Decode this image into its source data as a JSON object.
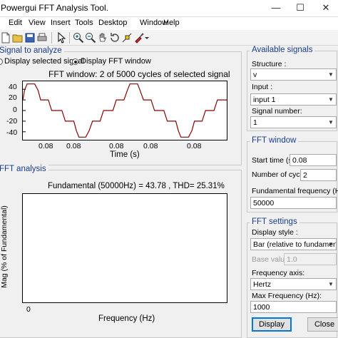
{
  "window": {
    "title": "Powergui FFT Analysis Tool."
  },
  "menu": [
    "Edit",
    "View",
    "Insert",
    "Tools",
    "Desktop",
    "Window",
    "Help"
  ],
  "toolbar_icons": [
    "new-file-icon",
    "open-folder-icon",
    "save-icon",
    "print-icon",
    "pointer-icon",
    "zoom-in-icon",
    "zoom-out-icon",
    "pan-hand-icon",
    "rotate-icon",
    "data-cursor-icon",
    "brush-icon",
    "dropdown-arrow-icon"
  ],
  "signal_panel": {
    "title": "Signal to analyze",
    "radio_selected_label": "Display selected signal",
    "radio_fft_label": "Display FFT window",
    "radio_fft_on": true,
    "plot_title": "FFT window: 2 of 5000 cycles of selected signal",
    "y_ticks": [
      "40",
      "20",
      "0",
      "-20",
      "-40"
    ],
    "x_ticks": [
      "0.08",
      "0.08",
      "0.08",
      "0.08",
      "0.08"
    ],
    "xlabel": "Time (s)",
    "line_color": "#8b0000"
  },
  "fft_panel": {
    "title": "FFT analysis",
    "plot_title": "Fundamental (50000Hz) = 43.78 , THD= 25.31%",
    "ylabel": "Mag (% of Fundamental)",
    "x_tick": "0",
    "xlabel": "Frequency (Hz)"
  },
  "available_signals": {
    "title": "Available signals",
    "structure_label": "Structure :",
    "structure_value": "v",
    "input_label": "Input :",
    "input_value": "input 1",
    "signal_number_label": "Signal number:",
    "signal_number_value": "1"
  },
  "fft_window": {
    "title": "FFT window",
    "start_time_label": "Start time (s):",
    "start_time_value": "0.08",
    "cycles_label": "Number of cycles:",
    "cycles_value": "2",
    "fund_freq_label": "Fundamental frequency (Hz):",
    "fund_freq_value": "50000"
  },
  "fft_settings": {
    "title": "FFT settings",
    "display_style_label": "Display style :",
    "display_style_value": "Bar (relative to fundamental)",
    "base_value_label": "Base value:",
    "base_value_value": "1.0",
    "freq_axis_label": "Frequency axis:",
    "freq_axis_value": "Hertz",
    "max_freq_label": "Max Frequency (Hz):",
    "max_freq_value": "1000"
  },
  "buttons": {
    "display": "Display",
    "close": "Close"
  },
  "chart_data": {
    "type": "line",
    "title": "FFT window: 2 of 5000 cycles of selected signal",
    "xlabel": "Time (s)",
    "ylabel": "",
    "ylim": [
      -55,
      55
    ],
    "y_ticks": [
      40,
      20,
      0,
      -20,
      -40
    ],
    "series": [
      {
        "values_description_free": true,
        "points": [
          [
            0,
            20
          ],
          [
            2,
            38
          ],
          [
            5,
            50
          ],
          [
            14,
            50
          ],
          [
            18,
            38
          ],
          [
            21,
            20
          ],
          [
            30,
            20
          ],
          [
            34,
            0
          ],
          [
            46,
            0
          ],
          [
            50,
            -20
          ],
          [
            60,
            -20
          ],
          [
            63,
            -38
          ],
          [
            66,
            -50
          ],
          [
            74,
            -50
          ],
          [
            78,
            -38
          ],
          [
            82,
            -20
          ],
          [
            91,
            -20
          ],
          [
            95,
            0
          ],
          [
            106,
            0
          ],
          [
            110,
            20
          ],
          [
            119,
            20
          ],
          [
            123,
            38
          ],
          [
            126,
            50
          ],
          [
            135,
            50
          ],
          [
            138,
            38
          ],
          [
            142,
            20
          ],
          [
            151,
            20
          ],
          [
            155,
            0
          ],
          [
            166,
            0
          ],
          [
            170,
            -20
          ],
          [
            180,
            -20
          ],
          [
            183,
            -38
          ],
          [
            186,
            -50
          ],
          [
            195,
            -50
          ],
          [
            199,
            -38
          ],
          [
            202,
            -20
          ],
          [
            211,
            -20
          ],
          [
            215,
            0
          ],
          [
            225,
            0
          ],
          [
            229,
            20
          ],
          [
            240,
            20
          ]
        ]
      }
    ]
  }
}
